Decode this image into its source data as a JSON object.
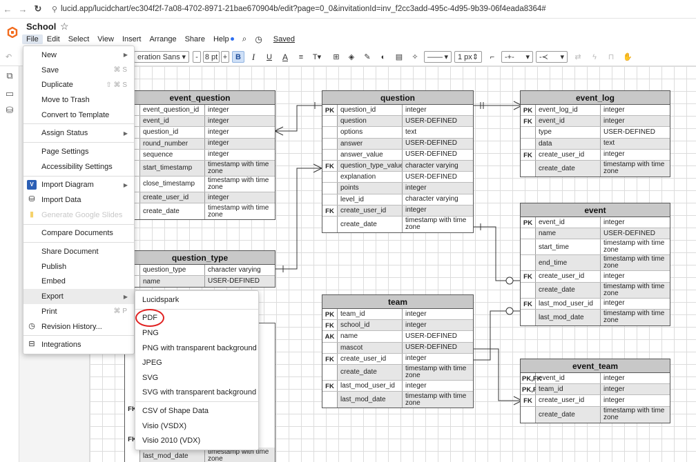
{
  "browser": {
    "url": "lucid.app/lucidchart/ec304f2f-7a08-4702-8971-21bae670904b/edit?page=0_0&invitationId=inv_f2cc3add-495c-4d95-9b39-06f4eada8364#"
  },
  "app": {
    "title": "School",
    "menu": [
      "File",
      "Edit",
      "Select",
      "View",
      "Insert",
      "Arrange",
      "Share",
      "Help"
    ],
    "saved_label": "Saved",
    "brand_color": "#f26b1d"
  },
  "toolbar": {
    "font": "eration Sans",
    "font_size": "8 pt",
    "minus": "-",
    "plus": "+",
    "bold": "B",
    "italic": "I",
    "underline": "U",
    "textcolor": "A",
    "line_width": "1 px"
  },
  "file_menu": [
    {
      "label": "New",
      "shortcut": "",
      "submenu": true
    },
    {
      "label": "Save",
      "shortcut": "⌘ S"
    },
    {
      "label": "Duplicate",
      "shortcut": "⇧ ⌘ S"
    },
    {
      "label": "Move to Trash",
      "shortcut": ""
    },
    {
      "label": "Convert to Template",
      "shortcut": ""
    },
    {
      "label": "Assign Status",
      "submenu": true
    },
    {
      "label": "Page Settings"
    },
    {
      "label": "Accessibility Settings"
    },
    {
      "label": "Import Diagram",
      "submenu": true
    },
    {
      "label": "Import Data"
    },
    {
      "label": "Generate Google Slides",
      "disabled": true
    },
    {
      "label": "Compare Documents"
    },
    {
      "label": "Share Document"
    },
    {
      "label": "Publish"
    },
    {
      "label": "Embed"
    },
    {
      "label": "Export",
      "submenu": true
    },
    {
      "label": "Print",
      "shortcut": "⌘ P"
    },
    {
      "label": "Revision History..."
    },
    {
      "label": "Integrations"
    }
  ],
  "export_menu": [
    "Lucidspark",
    "PDF",
    "PNG",
    "PNG with transparent background",
    "JPEG",
    "SVG",
    "SVG with transparent background",
    "CSV of Shape Data",
    "Visio (VSDX)",
    "Visio 2010 (VDX)"
  ],
  "tables": {
    "event_question": {
      "title": "event_question",
      "rows": [
        [
          "",
          "event_question_id",
          "integer"
        ],
        [
          "",
          "event_id",
          "integer"
        ],
        [
          "",
          "question_id",
          "integer"
        ],
        [
          "",
          "round_number",
          "integer"
        ],
        [
          "",
          "sequence",
          "integer"
        ],
        [
          "",
          "start_timestamp",
          "timestamp with time zone"
        ],
        [
          "",
          "close_timestamp",
          "timestamp with time zone"
        ],
        [
          "",
          "create_user_id",
          "integer"
        ],
        [
          "",
          "create_date",
          "timestamp with time zone"
        ]
      ]
    },
    "question": {
      "title": "question",
      "rows": [
        [
          "PK",
          "question_id",
          "integer"
        ],
        [
          "",
          "question",
          "USER-DEFINED"
        ],
        [
          "",
          "options",
          "text"
        ],
        [
          "",
          "answer",
          "USER-DEFINED"
        ],
        [
          "",
          "answer_value",
          "USER-DEFINED"
        ],
        [
          "FK",
          "question_type_value",
          "character varying"
        ],
        [
          "",
          "explanation",
          "USER-DEFINED"
        ],
        [
          "",
          "points",
          "integer"
        ],
        [
          "",
          "level_id",
          "character varying"
        ],
        [
          "FK",
          "create_user_id",
          "integer"
        ],
        [
          "",
          "create_date",
          "timestamp with time zone"
        ]
      ]
    },
    "event_log": {
      "title": "event_log",
      "rows": [
        [
          "PK",
          "event_log_id",
          "integer"
        ],
        [
          "FK",
          "event_id",
          "integer"
        ],
        [
          "",
          "type",
          "USER-DEFINED"
        ],
        [
          "",
          "data",
          "text"
        ],
        [
          "FK",
          "create_user_id",
          "integer"
        ],
        [
          "",
          "create_date",
          "timestamp with time zone"
        ]
      ]
    },
    "event": {
      "title": "event",
      "rows": [
        [
          "PK",
          "event_id",
          "integer"
        ],
        [
          "",
          "name",
          "USER-DEFINED"
        ],
        [
          "",
          "start_time",
          "timestamp with time zone"
        ],
        [
          "",
          "end_time",
          "timestamp with time zone"
        ],
        [
          "FK",
          "create_user_id",
          "integer"
        ],
        [
          "",
          "create_date",
          "timestamp with time zone"
        ],
        [
          "FK",
          "last_mod_user_id",
          "integer"
        ],
        [
          "",
          "last_mod_date",
          "timestamp with time zone"
        ]
      ]
    },
    "question_type": {
      "title": "question_type",
      "rows": [
        [
          "",
          "question_type",
          "character varying"
        ],
        [
          "",
          "name",
          "USER-DEFINED"
        ]
      ]
    },
    "team": {
      "title": "team",
      "rows": [
        [
          "PK",
          "team_id",
          "integer"
        ],
        [
          "FK",
          "school_id",
          "integer"
        ],
        [
          "AK",
          "name",
          "USER-DEFINED"
        ],
        [
          "",
          "mascot",
          "USER-DEFINED"
        ],
        [
          "FK",
          "create_user_id",
          "integer"
        ],
        [
          "",
          "create_date",
          "timestamp with time zone"
        ],
        [
          "FK",
          "last_mod_user_id",
          "integer"
        ],
        [
          "",
          "last_mod_date",
          "timestamp with time zone"
        ]
      ]
    },
    "event_team": {
      "title": "event_team",
      "rows": [
        [
          "PK,FK",
          "event_id",
          "integer"
        ],
        [
          "PK,FK",
          "team_id",
          "integer"
        ],
        [
          "FK",
          "create_user_id",
          "integer"
        ],
        [
          "",
          "create_date",
          "timestamp with time zone"
        ]
      ]
    },
    "hidden_left": {
      "rows": [
        [
          "FK",
          "",
          "me"
        ],
        [
          "FK",
          "",
          ""
        ],
        [
          "",
          "last_mod_date",
          "timestamp with time zone"
        ]
      ]
    }
  }
}
